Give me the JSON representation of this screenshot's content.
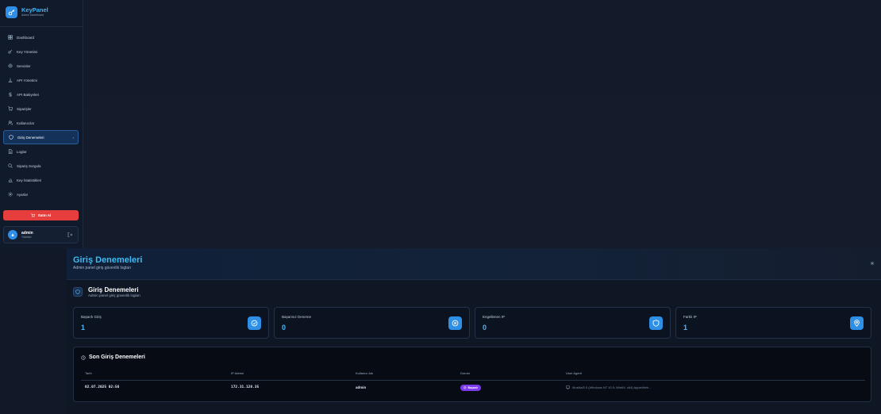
{
  "brand": {
    "name": "KeyPanel",
    "subtitle": "Admin Dashboard"
  },
  "sidebar": {
    "items": [
      {
        "label": "Dashboard",
        "icon": "dashboard-icon"
      },
      {
        "label": "Key Yönetimi",
        "icon": "key-icon"
      },
      {
        "label": "Servisler",
        "icon": "gear-icon"
      },
      {
        "label": "API Yönetimi",
        "icon": "api-icon"
      },
      {
        "label": "API Bakiyeleri",
        "icon": "dollar-icon"
      },
      {
        "label": "Siparişler",
        "icon": "cart-icon"
      },
      {
        "label": "Kullanıcılar",
        "icon": "users-icon"
      },
      {
        "label": "Giriş Denemeleri",
        "icon": "shield-icon",
        "active": true
      },
      {
        "label": "Loglar",
        "icon": "file-icon"
      },
      {
        "label": "Sipariş Sorgula",
        "icon": "search-icon"
      },
      {
        "label": "Key İstatistikleri",
        "icon": "chart-icon"
      },
      {
        "label": "Ayarlar",
        "icon": "settings-icon"
      }
    ],
    "logout_label": "Satın Al",
    "user": {
      "name": "admin",
      "role": "Yönetici"
    }
  },
  "header": {
    "title": "Giriş Denemeleri",
    "subtitle": "Admin panel giriş güvenlik logları"
  },
  "section": {
    "title": "Giriş Denemeleri",
    "subtitle": "Admin panel giriş güvenlik logları"
  },
  "stats": [
    {
      "label": "Başarılı Giriş",
      "value": "1",
      "icon": "check-circle-icon"
    },
    {
      "label": "Başarısız Deneme",
      "value": "0",
      "icon": "x-circle-icon"
    },
    {
      "label": "Engellenen IP",
      "value": "0",
      "icon": "shield-icon"
    },
    {
      "label": "Farklı IP",
      "value": "1",
      "icon": "location-icon"
    }
  ],
  "table": {
    "title": "Son Giriş Denemeleri",
    "columns": [
      "Tarih",
      "IP Adresi",
      "Kullanıcı Adı",
      "Durum",
      "User Agent"
    ],
    "rows": [
      {
        "date": "02.07.2025 02:56",
        "ip": "172.31.128.35",
        "username": "admin",
        "status": "Başarılı",
        "user_agent": "Mozilla/5.0 (Windows NT 10.0; Win64; x64) AppleWeb..."
      }
    ]
  },
  "colors": {
    "accent": "#2f8fe8",
    "title": "#3bbcf6",
    "danger": "#e63d3d",
    "success_badge": "#7c3aed"
  }
}
